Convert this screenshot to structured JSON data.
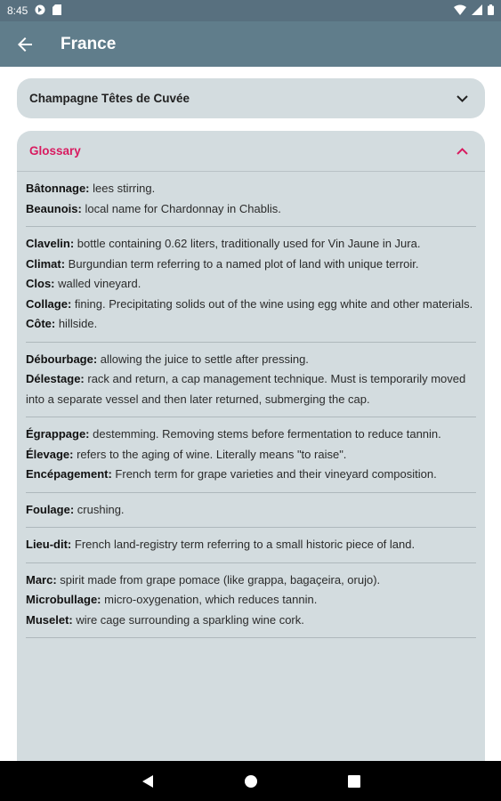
{
  "status": {
    "time": "8:45"
  },
  "appbar": {
    "title": "France"
  },
  "section_collapsed": {
    "title": "Champagne Têtes de Cuvée"
  },
  "glossary": {
    "title": "Glossary",
    "groups": [
      [
        {
          "term": "Bâtonnage:",
          "def": " lees stirring."
        },
        {
          "term": "Beaunois:",
          "def": " local name for Chardonnay in Chablis."
        }
      ],
      [
        {
          "term": "Clavelin:",
          "def": " bottle containing 0.62 liters, traditionally used for Vin Jaune in Jura."
        },
        {
          "term": "Climat:",
          "def": " Burgundian term referring to a named plot of land with unique terroir."
        },
        {
          "term": "Clos:",
          "def": " walled vineyard."
        },
        {
          "term": "Collage:",
          "def": " fining. Precipitating solids out of the wine using egg white and other materials."
        },
        {
          "term": "Côte:",
          "def": " hillside."
        }
      ],
      [
        {
          "term": "Débourbage:",
          "def": " allowing the juice to settle after pressing."
        },
        {
          "term": "Délestage:",
          "def": " rack and return, a cap management technique. Must is temporarily moved into a separate vessel and then later returned, submerging the cap."
        }
      ],
      [
        {
          "term": "Égrappage:",
          "def": " destemming. Removing stems before fermentation to reduce tannin."
        },
        {
          "term": "Élevage:",
          "def": " refers to the aging of wine. Literally means \"to raise\"."
        },
        {
          "term": "Encépagement:",
          "def": " French term for grape varieties and their vineyard composition."
        }
      ],
      [
        {
          "term": "Foulage:",
          "def": " crushing."
        }
      ],
      [
        {
          "term": "Lieu-dit:",
          "def": " French land-registry term referring to a small historic piece of land."
        }
      ],
      [
        {
          "term": "Marc:",
          "def": " spirit made from grape pomace (like grappa, bagaçeira, orujo)."
        },
        {
          "term": "Microbullage:",
          "def": " micro-oxygenation, which reduces tannin."
        },
        {
          "term": "Muselet:",
          "def": " wire cage surrounding a sparkling wine cork."
        }
      ]
    ]
  },
  "colors": {
    "appbar": "#607d8b",
    "accent": "#d81b60",
    "card": "#d3dcdf"
  },
  "icons": [
    "back-arrow-icon",
    "chevron-down-icon",
    "chevron-up-icon",
    "nav-back-icon",
    "nav-home-icon",
    "nav-recents-icon"
  ]
}
